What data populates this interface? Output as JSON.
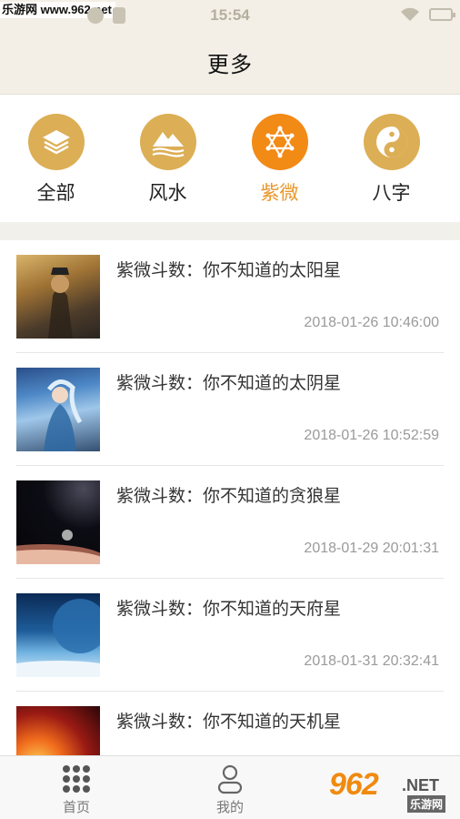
{
  "status_bar": {
    "watermark": "乐游网 www.962.net",
    "time": "15:54"
  },
  "header": {
    "title": "更多"
  },
  "categories": [
    {
      "label": "全部",
      "icon": "layers-icon",
      "active": false
    },
    {
      "label": "风水",
      "icon": "mountain-icon",
      "active": false
    },
    {
      "label": "紫微",
      "icon": "star-of-david-icon",
      "active": true
    },
    {
      "label": "八字",
      "icon": "yin-yang-icon",
      "active": false
    }
  ],
  "articles": [
    {
      "title": "紫微斗数：你不知道的太阳星",
      "time": "2018-01-26 10:46:00"
    },
    {
      "title": "紫微斗数：你不知道的太阴星",
      "time": "2018-01-26 10:52:59"
    },
    {
      "title": "紫微斗数：你不知道的贪狼星",
      "time": "2018-01-29 20:01:31"
    },
    {
      "title": "紫微斗数：你不知道的天府星",
      "time": "2018-01-31 20:32:41"
    },
    {
      "title": "紫微斗数：你不知道的天机星",
      "time": ""
    }
  ],
  "bottom_nav": {
    "home_label": "首页",
    "mine_label": "我的",
    "logo_main": "962",
    "logo_net": ".NET",
    "logo_sub": "乐游网"
  },
  "colors": {
    "accent_gold": "#dcae55",
    "accent_orange": "#f28a16",
    "active_text": "#e9972b",
    "header_bg": "#f3efe6"
  }
}
